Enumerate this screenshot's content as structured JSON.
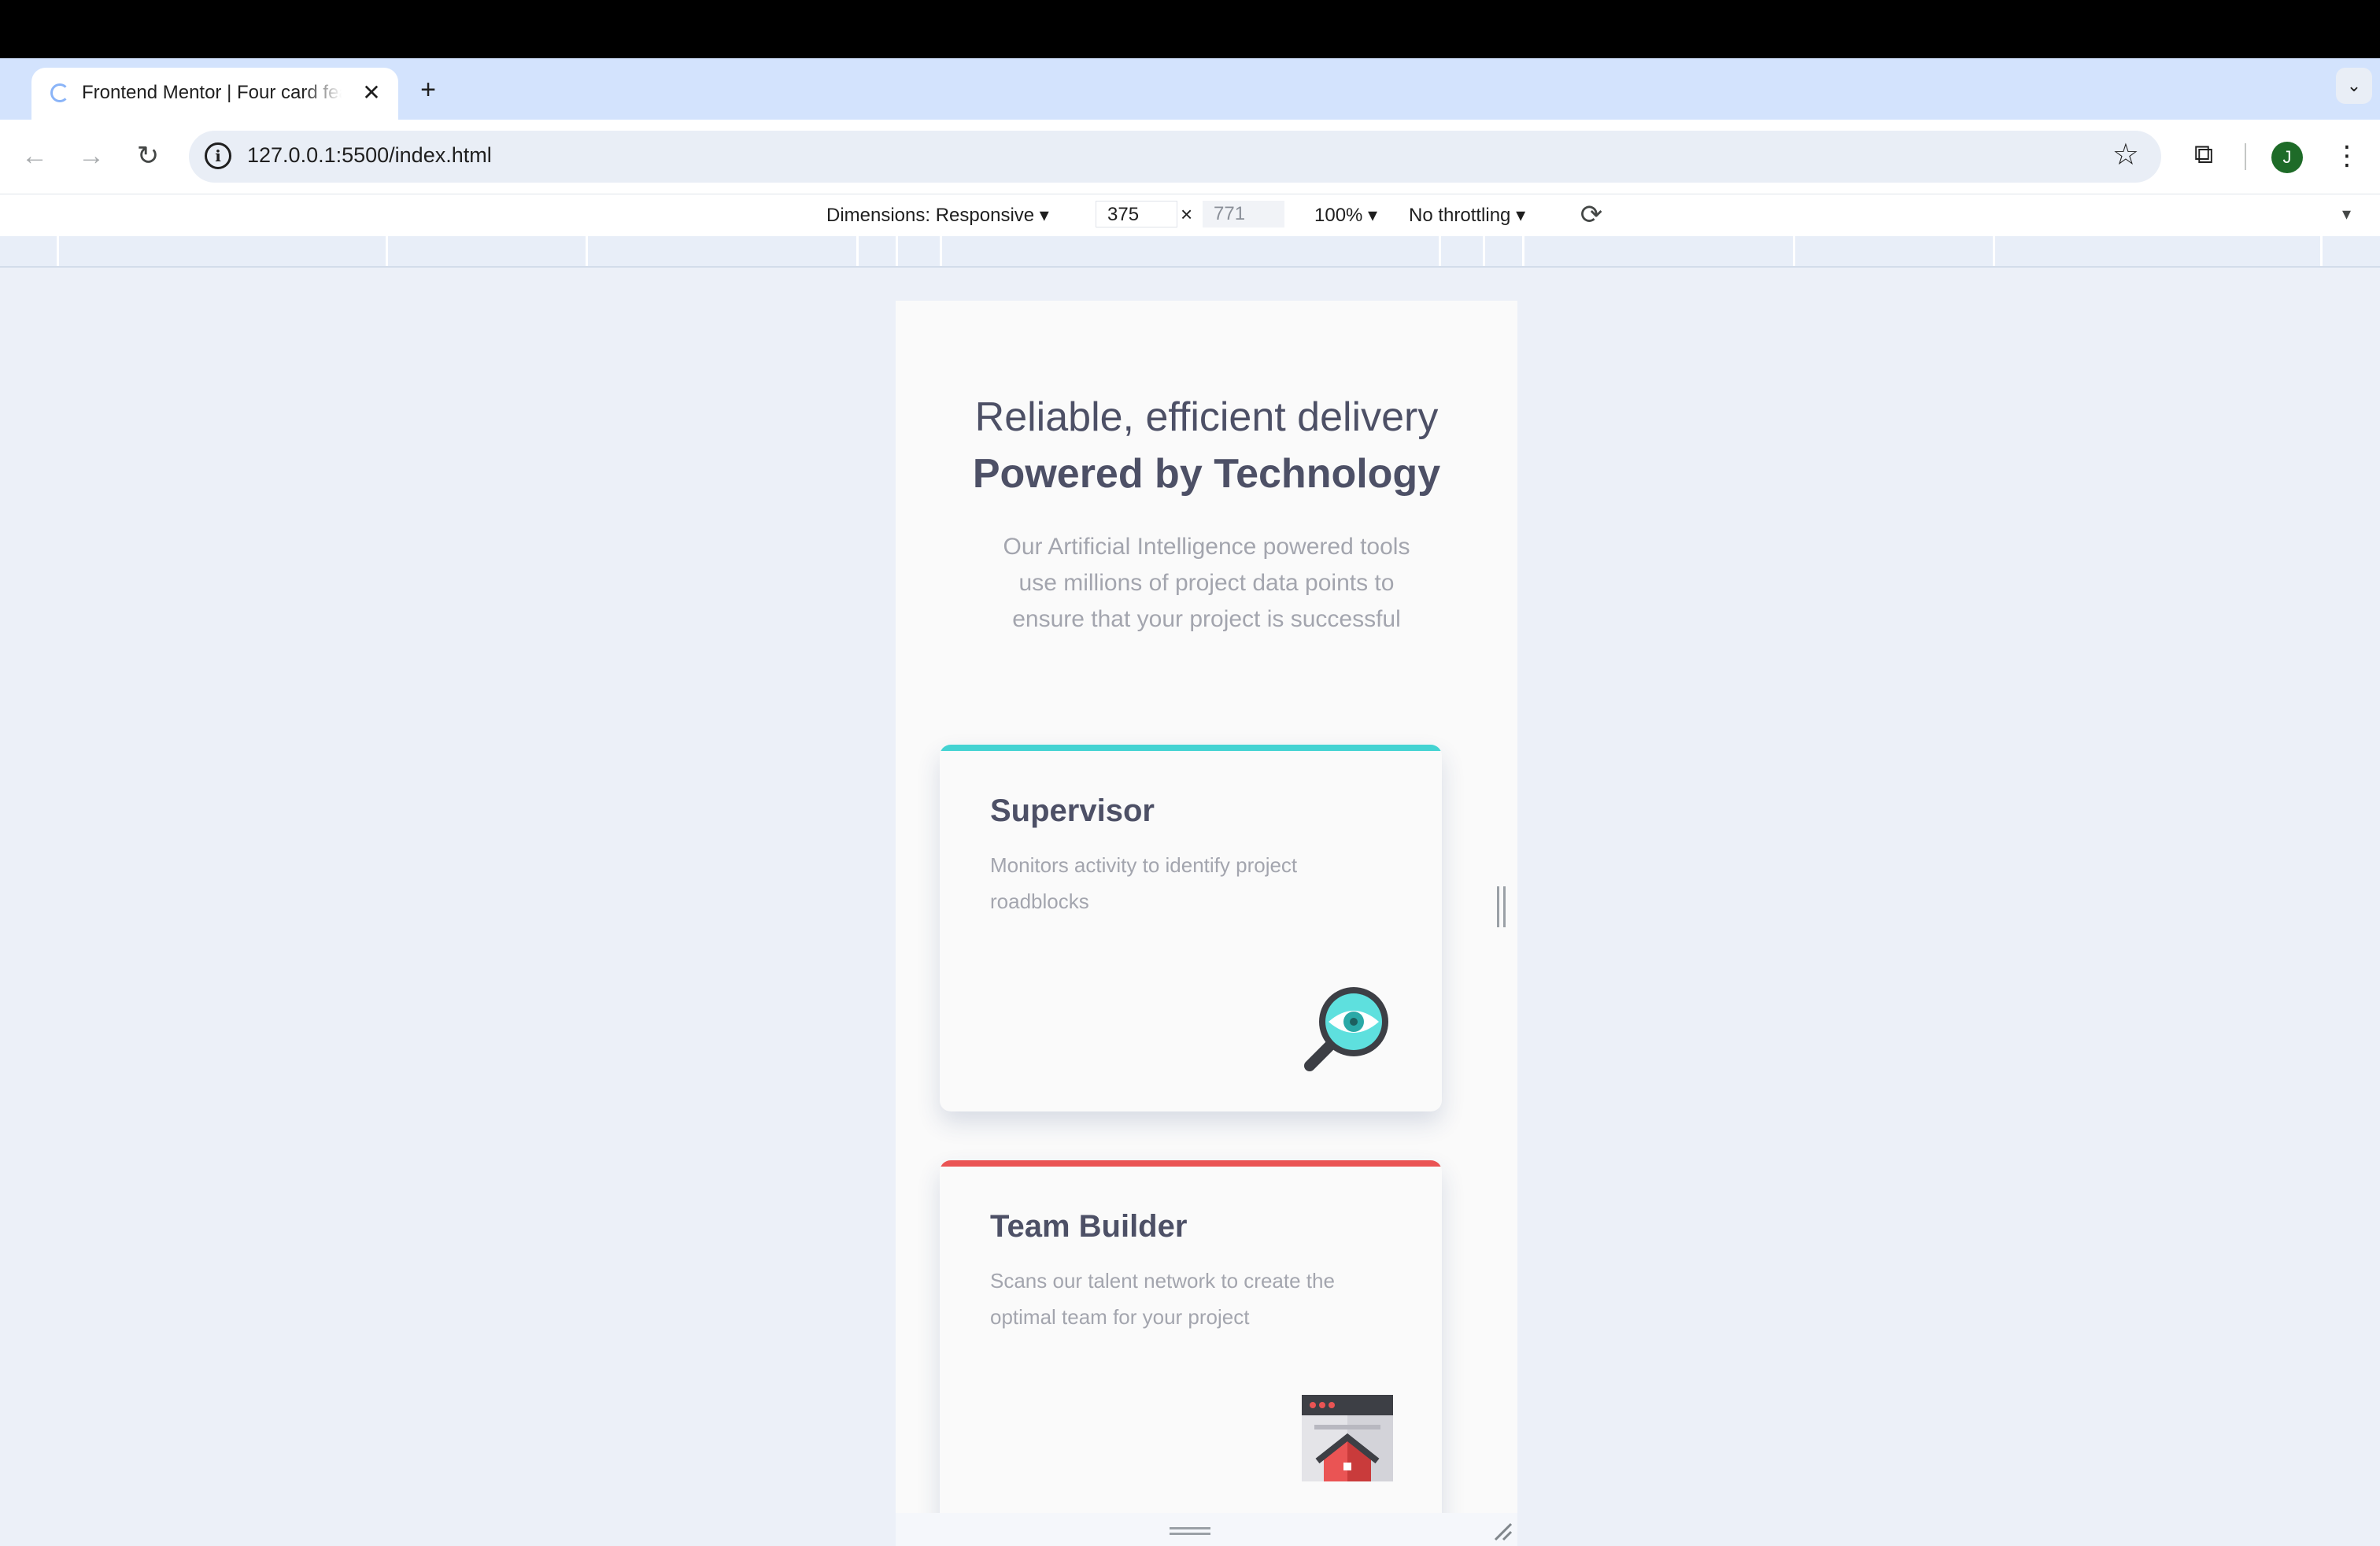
{
  "browser": {
    "tab": {
      "title": "Frontend Mentor | Four card feature section",
      "close_glyph": "✕"
    },
    "new_tab_glyph": "+",
    "tab_search_glyph": "⌄",
    "nav": {
      "back_glyph": "←",
      "forward_glyph": "→",
      "reload_glyph": "↻"
    },
    "site_info_glyph": "i",
    "url": "127.0.0.1:5500/index.html",
    "bookmark_glyph": "☆",
    "extensions_glyph": "⧉",
    "profile_initial": "J",
    "menu_glyph": "⋮",
    "profile_color": "#1e6b28"
  },
  "device_toolbar": {
    "dimensions": "Dimensions: Responsive ▾",
    "width": "375",
    "height": "771",
    "times": "×",
    "zoom": "100% ▾",
    "throttling": "No throttling ▾",
    "rotate_glyph": "⟳",
    "more_glyph": "▾"
  },
  "page": {
    "heading_light": "Reliable, efficient delivery",
    "heading_bold": "Powered by Technology",
    "description_lines": [
      "Our Artificial Intelligence powered tools",
      "use millions of project data points to",
      "ensure that your project is successful"
    ],
    "cards": [
      {
        "title": "Supervisor",
        "description_lines": [
          "Monitors activity to identify project",
          "roadblocks"
        ],
        "accent": "#44d3d2",
        "icon": "supervisor-magnifier-icon"
      },
      {
        "title": "Team Builder",
        "description_lines": [
          "Scans our talent network to create the",
          "optimal team for your project"
        ],
        "accent": "#ea5454",
        "icon": "team-builder-icon"
      }
    ]
  }
}
